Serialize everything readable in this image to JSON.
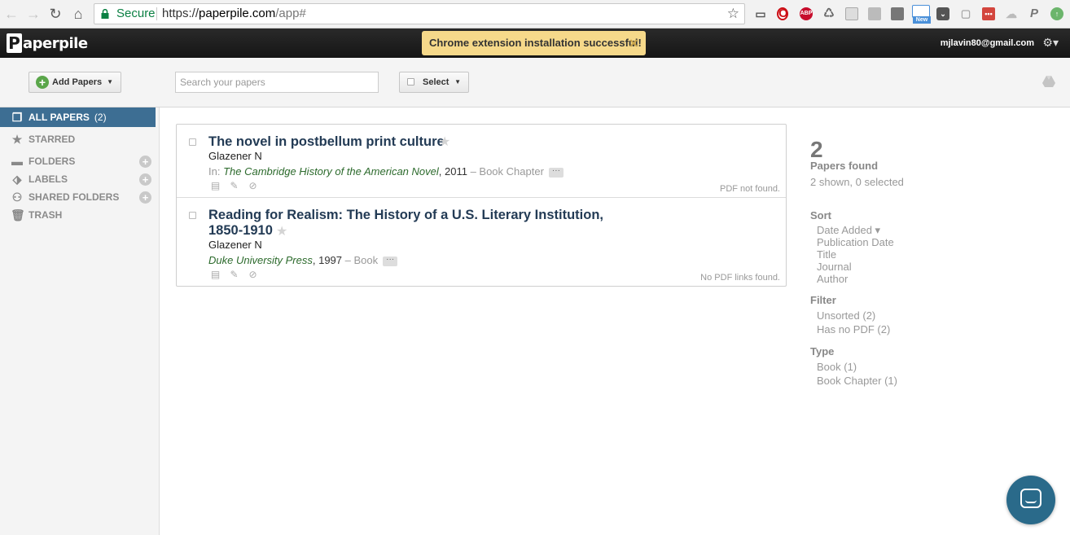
{
  "browser": {
    "secure_label": "Secure",
    "url_scheme": "https://",
    "url_domain": "paperpile.com",
    "url_path": "/app#",
    "extensions": [
      "cast-icon",
      "opera-icon",
      "abp-icon",
      "recycle-icon",
      "doc-icon",
      "news-icon",
      "ext-icon",
      "new-badge-icon",
      "pocket-icon",
      "chat-ext-icon",
      "lastpass-icon",
      "cloud-icon",
      "paperpile-ext-icon",
      "upload-icon"
    ],
    "new_badge": "New",
    "abp_label": "ABP"
  },
  "header": {
    "logo_p": "P",
    "logo_rest": "aperpile",
    "notice": "Chrome extension installation successful!",
    "notice_close": "✕",
    "user_email": "mjlavin80@gmail.com"
  },
  "toolbar": {
    "add_papers_label": "Add Papers",
    "search_placeholder": "Search your papers",
    "select_label": "Select"
  },
  "sidebar": {
    "all_papers": {
      "label": "ALL PAPERS",
      "count": "(2)"
    },
    "starred": "STARRED",
    "folders": "FOLDERS",
    "labels": "LABELS",
    "shared_folders": "SHARED FOLDERS",
    "trash": "TRASH"
  },
  "papers": [
    {
      "title": "The novel in postbellum print culture",
      "author": "Glazener N",
      "prefix": "In: ",
      "source": "The Cambridge History of the American Novel",
      "year": ", 2011",
      "type": " – Book Chapter",
      "pdf_status": "PDF not found."
    },
    {
      "title_line1": "Reading for Realism: The History of a U.S. Literary Institution,",
      "title_line2": "1850-1910",
      "author": "Glazener N",
      "source": "Duke University Press",
      "year": ", 1997",
      "type": " – Book",
      "pdf_status": "No PDF links found."
    }
  ],
  "stats": {
    "count": "2",
    "found_label": "Papers found",
    "shown_label": "2 shown, 0 selected",
    "sort_head": "Sort",
    "sort_items": [
      "Date Added ▾",
      "Publication Date",
      "Title",
      "Journal",
      "Author"
    ],
    "filter_head": "Filter",
    "filter_items": [
      "Unsorted (2)",
      "Has no PDF (2)"
    ],
    "type_head": "Type",
    "type_items": [
      "Book (1)",
      "Book Chapter (1)"
    ]
  }
}
